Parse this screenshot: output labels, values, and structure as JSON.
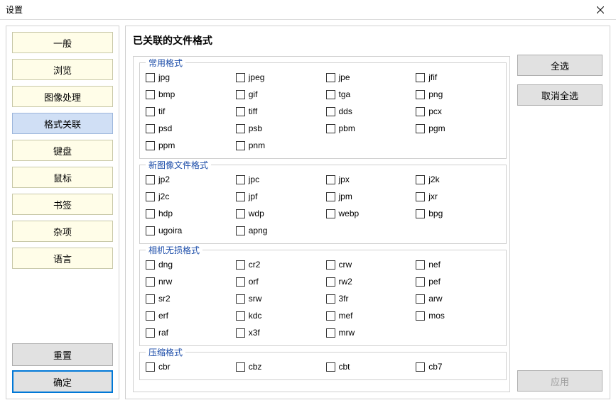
{
  "window": {
    "title": "设置"
  },
  "sidebar": {
    "items": [
      {
        "label": "一般",
        "selected": false
      },
      {
        "label": "浏览",
        "selected": false
      },
      {
        "label": "图像处理",
        "selected": false
      },
      {
        "label": "格式关联",
        "selected": true
      },
      {
        "label": "键盘",
        "selected": false
      },
      {
        "label": "鼠标",
        "selected": false
      },
      {
        "label": "书签",
        "selected": false
      },
      {
        "label": "杂项",
        "selected": false
      },
      {
        "label": "语言",
        "selected": false
      }
    ],
    "reset": "重置",
    "ok": "确定"
  },
  "main": {
    "title": "已关联的文件格式",
    "groups": [
      {
        "title": "常用格式",
        "items": [
          "jpg",
          "jpeg",
          "jpe",
          "jfif",
          "bmp",
          "gif",
          "tga",
          "png",
          "tif",
          "tiff",
          "dds",
          "pcx",
          "psd",
          "psb",
          "pbm",
          "pgm",
          "ppm",
          "pnm"
        ]
      },
      {
        "title": "新图像文件格式",
        "items": [
          "jp2",
          "jpc",
          "jpx",
          "j2k",
          "j2c",
          "jpf",
          "jpm",
          "jxr",
          "hdp",
          "wdp",
          "webp",
          "bpg",
          "ugoira",
          "apng"
        ]
      },
      {
        "title": "相机无损格式",
        "items": [
          "dng",
          "cr2",
          "crw",
          "nef",
          "nrw",
          "orf",
          "rw2",
          "pef",
          "sr2",
          "srw",
          "3fr",
          "arw",
          "erf",
          "kdc",
          "mef",
          "mos",
          "raf",
          "x3f",
          "mrw"
        ]
      },
      {
        "title": "压缩格式",
        "items": [
          "cbr",
          "cbz",
          "cbt",
          "cb7"
        ]
      }
    ],
    "selectAll": "全选",
    "deselectAll": "取消全选",
    "apply": "应用"
  }
}
